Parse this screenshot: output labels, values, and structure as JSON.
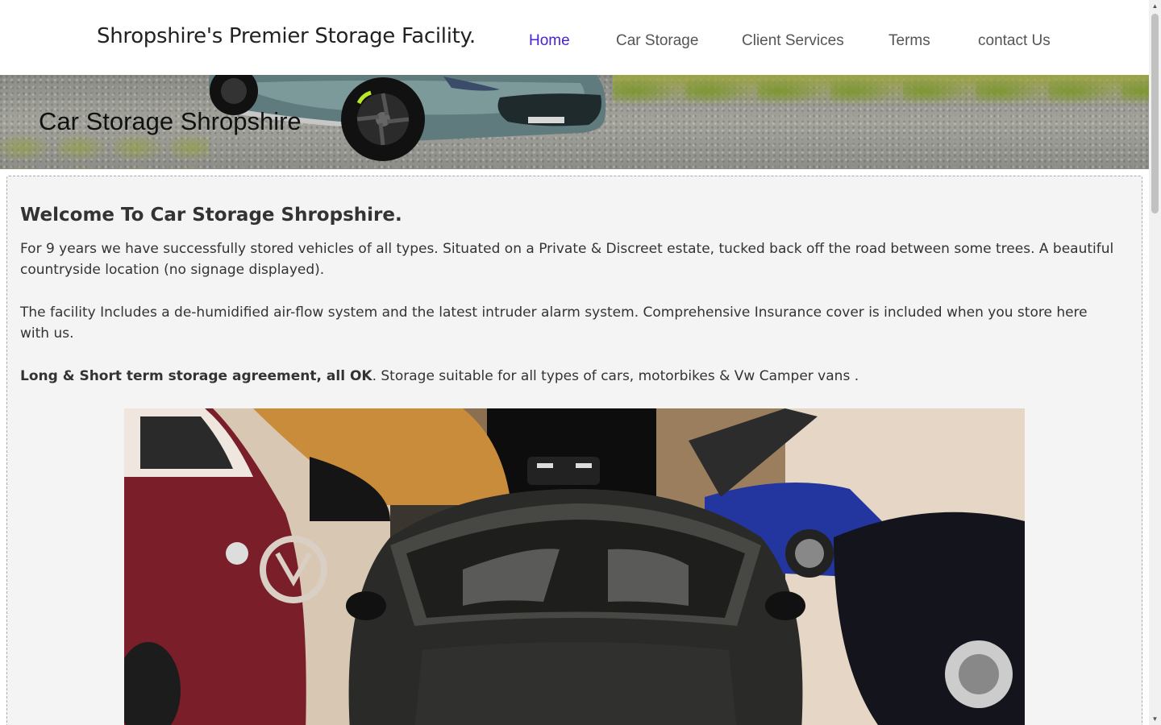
{
  "header": {
    "site_title": "Shropshire's Premier Storage Facility.",
    "nav": [
      {
        "label": "Home",
        "active": true
      },
      {
        "label": "Car Storage",
        "active": false
      },
      {
        "label": "Client Services",
        "active": false
      },
      {
        "label": "Terms",
        "active": false
      },
      {
        "label": "contact Us",
        "active": false
      }
    ]
  },
  "banner": {
    "title": "Car Storage Shropshire"
  },
  "main": {
    "heading": "Welcome To Car Storage Shropshire.",
    "paragraph1": "For 9 years we have successfully stored vehicles of all types. Situated on a Private & Discreet estate, tucked back off the road between some trees. A beautiful countryside location (no signage displayed).",
    "paragraph2": "The facility Includes a de-humidified air-flow system and the latest intruder alarm system. Comprehensive Insurance cover is included when you store here with us.",
    "paragraph3_bold": "Long & Short term storage agreement, all OK",
    "paragraph3_rest": ". Storage suitable for all types of cars, motorbikes & Vw Camper vans ."
  },
  "colors": {
    "nav_active": "#4a22d6",
    "nav_default": "#555555",
    "panel_bg": "#f4f4f4"
  },
  "scrollbar": {
    "up_icon": "triangle-up-icon",
    "down_icon": "triangle-down-icon"
  }
}
